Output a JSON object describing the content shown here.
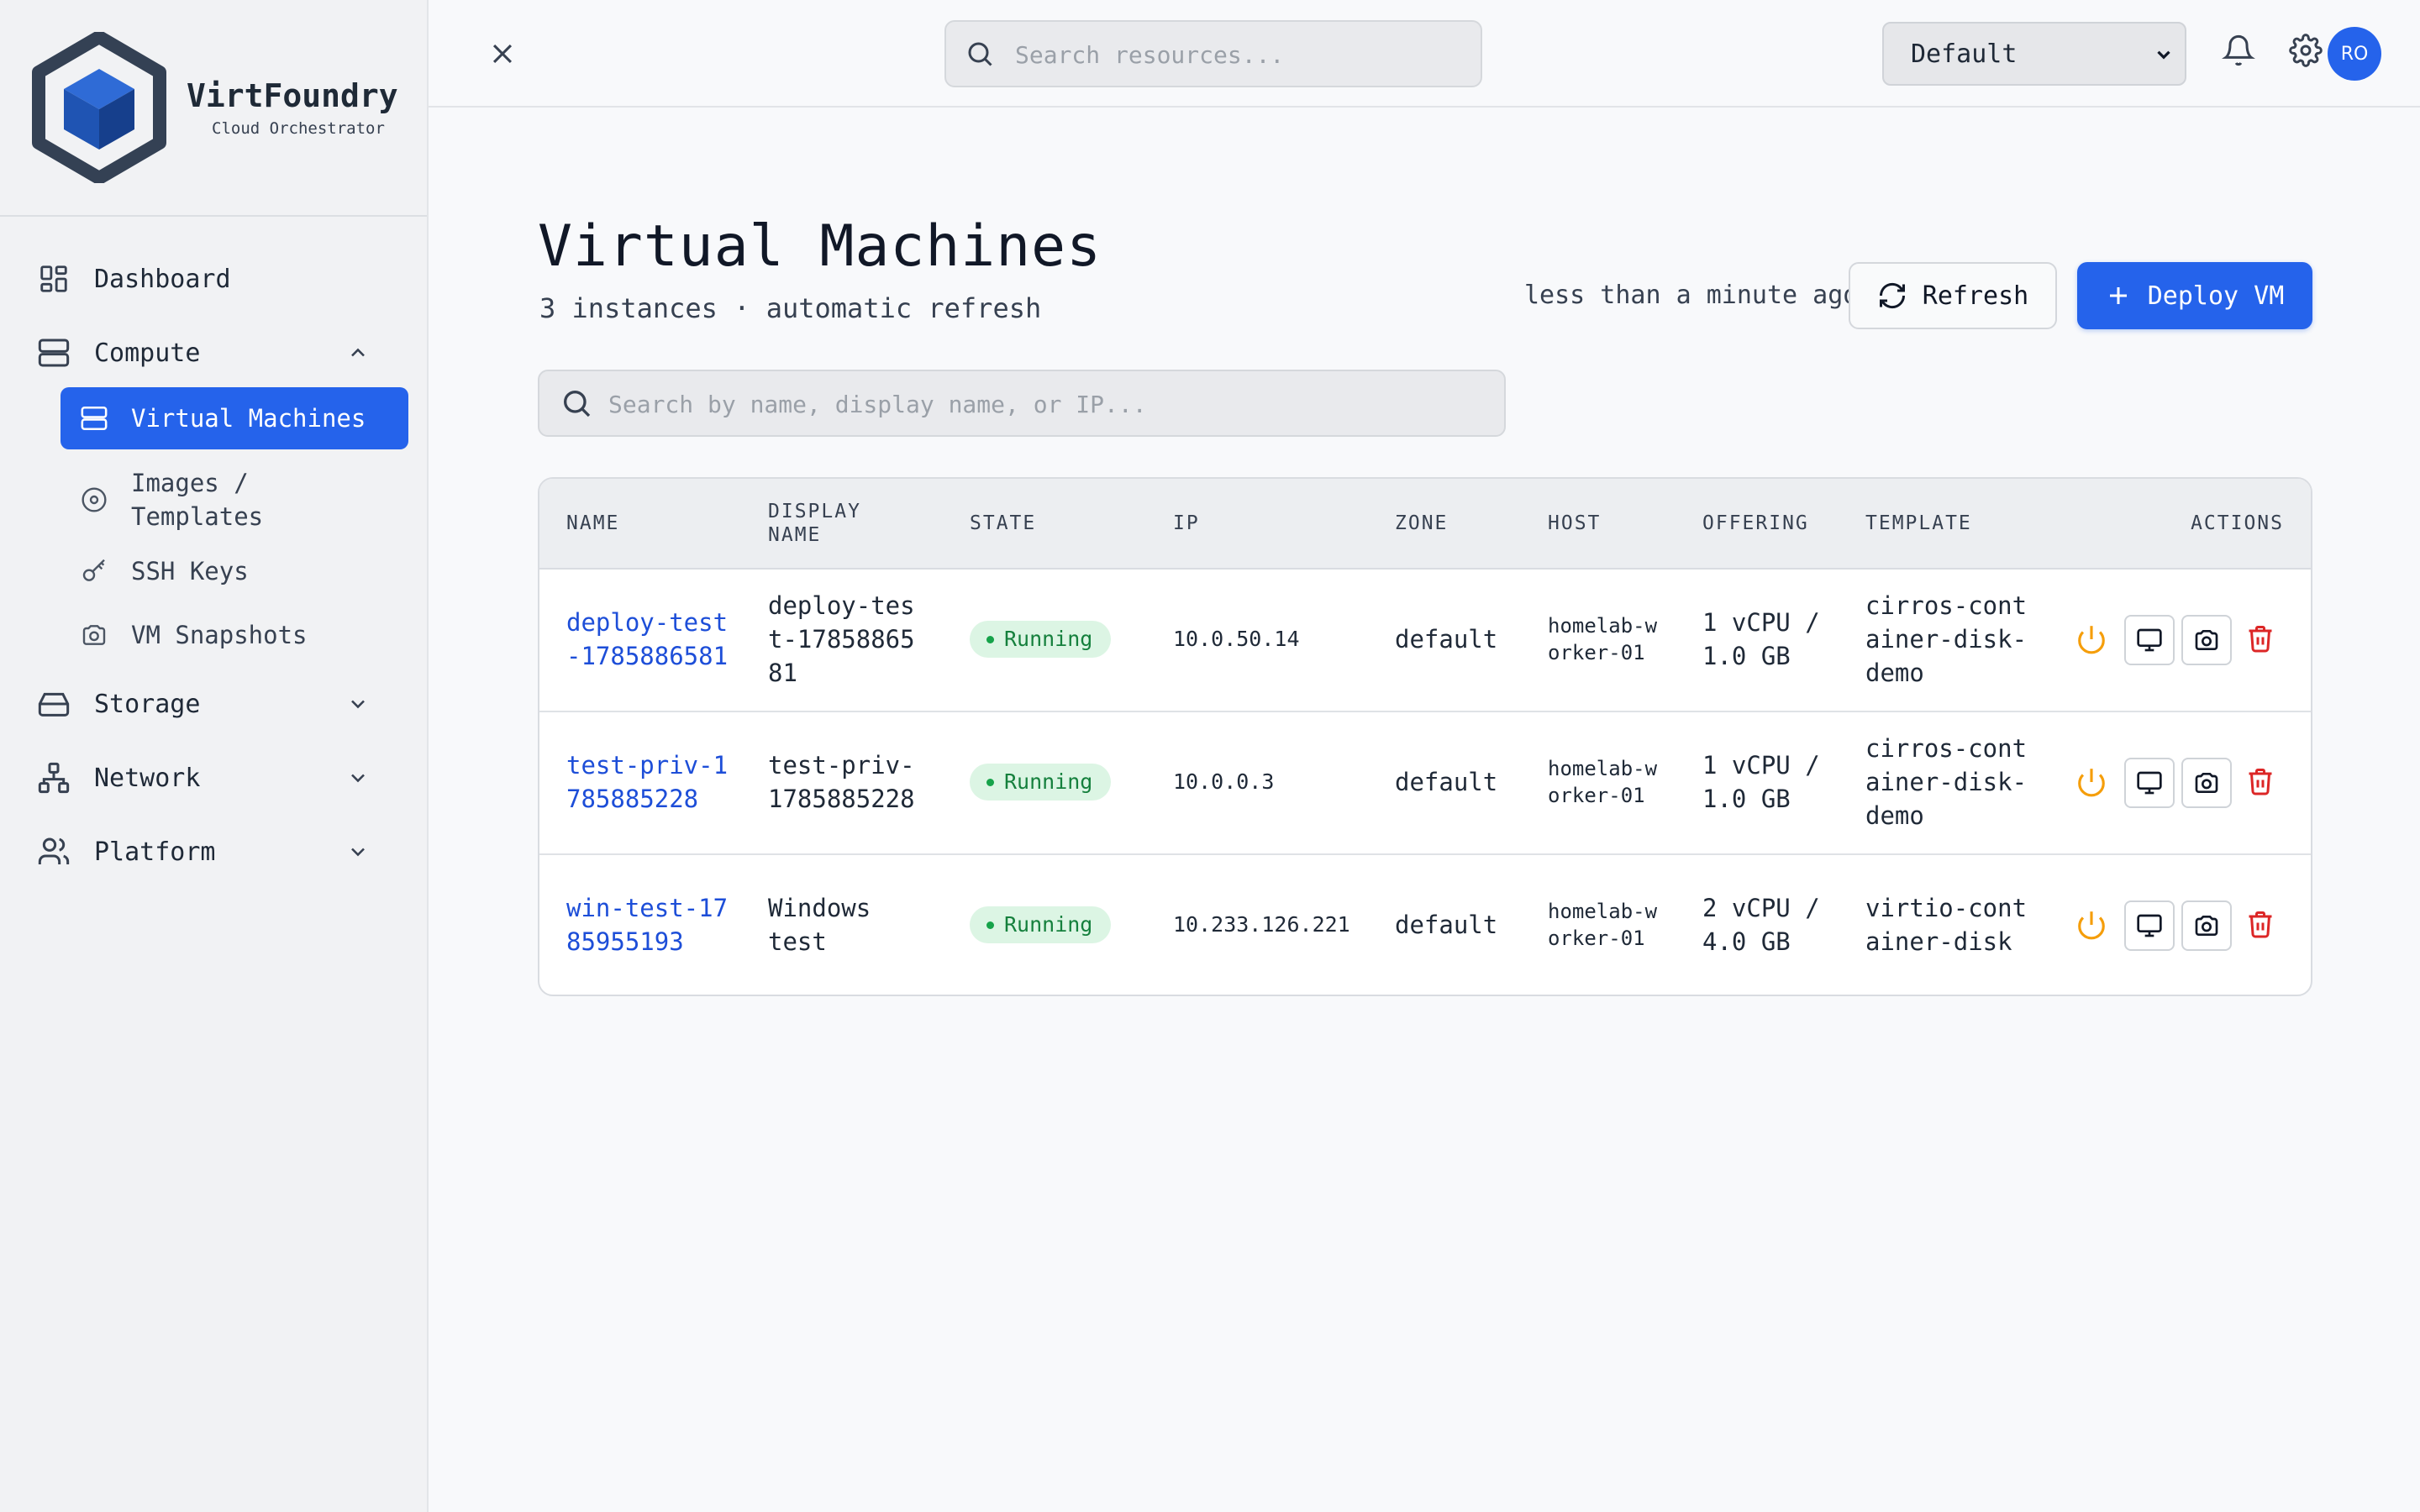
{
  "brand": {
    "name": "VirtFoundry",
    "subtitle": "Cloud Orchestrator"
  },
  "sidebar": {
    "items": [
      {
        "label": "Dashboard",
        "icon": "dashboard-icon"
      },
      {
        "label": "Compute",
        "icon": "server-icon",
        "expanded": true,
        "children": [
          {
            "label": "Virtual Machines",
            "icon": "server-icon",
            "active": true
          },
          {
            "label": "Images / Templates",
            "icon": "disc-icon"
          },
          {
            "label": "SSH Keys",
            "icon": "key-icon"
          },
          {
            "label": "VM Snapshots",
            "icon": "camera-icon"
          }
        ]
      },
      {
        "label": "Storage",
        "icon": "hard-drive-icon",
        "expanded": false
      },
      {
        "label": "Network",
        "icon": "network-icon",
        "expanded": false
      },
      {
        "label": "Platform",
        "icon": "users-icon",
        "expanded": false
      }
    ]
  },
  "topbar": {
    "search_placeholder": "Search resources...",
    "environment": "Default",
    "avatar_initials": "RO"
  },
  "page": {
    "title": "Virtual Machines",
    "subtitle": "3 instances · automatic refresh",
    "last_updated": "less than a minute ago",
    "refresh_label": "Refresh",
    "deploy_label": "Deploy VM",
    "search_placeholder": "Search by name, display name, or IP..."
  },
  "table": {
    "columns": [
      "NAME",
      "DISPLAY NAME",
      "STATE",
      "IP",
      "ZONE",
      "HOST",
      "OFFERING",
      "TEMPLATE",
      "ACTIONS"
    ],
    "rows": [
      {
        "name": "deploy-test-1785886581",
        "display_name": "deploy-test-1785886581",
        "state": "Running",
        "ip": "10.0.50.14",
        "zone": "default",
        "host": "homelab-worker-01",
        "offering": "1 vCPU / 1.0 GB",
        "template": "cirros-container-disk-demo"
      },
      {
        "name": "test-priv-1785885228",
        "display_name": "test-priv-1785885228",
        "state": "Running",
        "ip": "10.0.0.3",
        "zone": "default",
        "host": "homelab-worker-01",
        "offering": "1 vCPU / 1.0 GB",
        "template": "cirros-container-disk-demo"
      },
      {
        "name": "win-test-1785955193",
        "display_name": "Windows test",
        "state": "Running",
        "ip": "10.233.126.221",
        "zone": "default",
        "host": "homelab-worker-01",
        "offering": "2 vCPU / 4.0 GB",
        "template": "virtio-container-disk"
      }
    ]
  },
  "colors": {
    "accent": "#2563eb",
    "link": "#1d4ed8",
    "running_bg": "#dcf5e4",
    "running_text": "#15803d",
    "power": "#f59e0b",
    "danger": "#dc2626"
  }
}
